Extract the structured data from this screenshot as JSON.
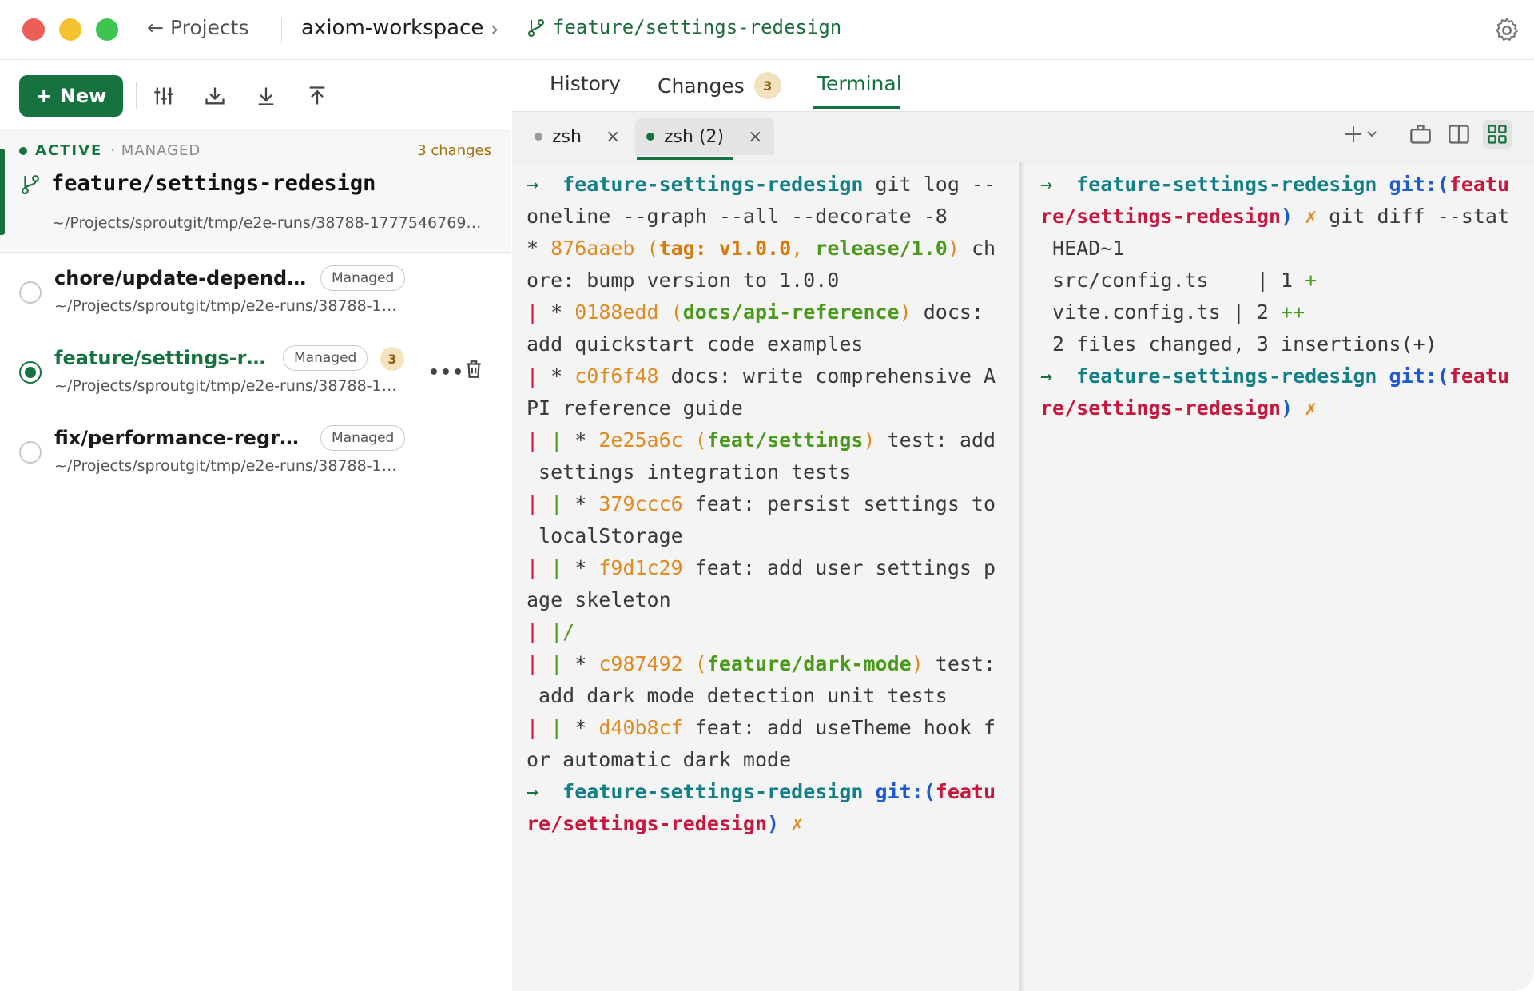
{
  "topbar": {
    "back_label": "Projects",
    "workspace": "axiom-workspace",
    "branch": "feature/settings-redesign"
  },
  "sidebar": {
    "new_label": "New",
    "active": {
      "status": "ACTIVE",
      "type": "· MANAGED",
      "changes": "3 changes",
      "branch": "feature/settings-redesign",
      "path": "~/Projects/sproutgit/tmp/e2e-runs/38788-1777546769…"
    },
    "items": [
      {
        "name": "chore/update-dependen…",
        "tag": "Managed",
        "path": "~/Projects/sproutgit/tmp/e2e-runs/38788-1…"
      },
      {
        "name": "feature/settings-red…",
        "tag": "Managed",
        "badge": "3",
        "path": "~/Projects/sproutgit/tmp/e2e-runs/38788-1…"
      },
      {
        "name": "fix/performance-regressi…",
        "tag": "Managed",
        "path": "~/Projects/sproutgit/tmp/e2e-runs/38788-1…"
      }
    ]
  },
  "tabs": {
    "history": "History",
    "changes": "Changes",
    "changes_badge": "3",
    "terminal": "Terminal"
  },
  "terminal_tabs": [
    {
      "label": "zsh"
    },
    {
      "label": "zsh (2)"
    }
  ],
  "pane1": {
    "l1_branch": "feature-settings-redesign",
    "l1_cmd": " git log --",
    "l2": "oneline --graph --all --decorate -8",
    "l3_star": "* ",
    "l3_hash": "876aaeb",
    "l3_paren_open": " (",
    "l3_tag": "tag: v1.0.0",
    "l3_comma": ", ",
    "l3_ref": "release/1.0",
    "l3_paren_close": ")",
    "l3_msg": " ch",
    "l4": "ore: bump version to 1.0.0",
    "l5_hash": "0188edd",
    "l5_ref": "docs/api-reference",
    "l5_msg": " docs:",
    "l6": "add quickstart code examples",
    "l7_hash": "c0f6f48",
    "l7_msg": " docs: write comprehensive A",
    "l8": "PI reference guide",
    "l9_hash": "2e25a6c",
    "l9_ref": "feat/settings",
    "l9_msg": " test: add",
    "l10": " settings integration tests",
    "l11_hash": "379ccc6",
    "l11_msg": " feat: persist settings to",
    "l12": " localStorage",
    "l13_hash": "f9d1c29",
    "l13_msg": " feat: add user settings p",
    "l14": "age skeleton",
    "l16_hash": "c987492",
    "l16_ref": "feature/dark-mode",
    "l16_msg": " test:",
    "l17": " add dark mode detection unit tests",
    "l18_hash": "d40b8cf",
    "l18_msg": " feat: add useTheme hook f",
    "l19": "or automatic dark mode",
    "prompt_branch": "feature-settings-redesign",
    "prompt_git": " git:(",
    "prompt_ref1": "featu",
    "prompt_ref2": "re/settings-redesign",
    "prompt_close": ")",
    "prompt_x": " ✗"
  },
  "pane2": {
    "l1_branch": "feature-settings-redesign",
    "l1_git": " git:(",
    "l1_ref": "featu",
    "l2_ref": "re/settings-redesign",
    "l2_close": ")",
    "l2_x": " ✗",
    "l2_cmd": " git diff --stat",
    "l3": " HEAD~1",
    "l4_file": " src/config.ts    | 1 ",
    "l4_plus": "+",
    "l5_file": " vite.config.ts | 2 ",
    "l5_plus": "++",
    "l6": " 2 files changed, 3 insertions(+)",
    "l7_branch": "feature-settings-redesign",
    "l7_git": " git:(",
    "l7_ref": "featu",
    "l8_ref": "re/settings-redesign",
    "l8_close": ")",
    "l8_x": " ✗"
  },
  "colors": {
    "accent": "#16733f",
    "badge_bg": "#f3e2bf",
    "terminal_bg": "#f4f4f4"
  }
}
